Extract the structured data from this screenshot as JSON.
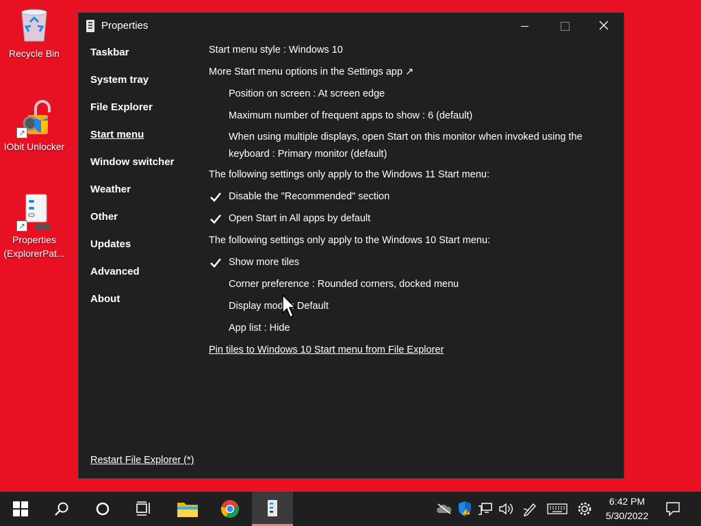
{
  "desktop": {
    "icons": [
      {
        "label": "Recycle Bin"
      },
      {
        "label": "IObit Unlocker"
      },
      {
        "label": "Properties (ExplorerPat..."
      }
    ]
  },
  "window": {
    "title": "Properties",
    "nav": [
      "Taskbar",
      "System tray",
      "File Explorer",
      "Start menu",
      "Window switcher",
      "Weather",
      "Other",
      "Updates",
      "Advanced",
      "About"
    ],
    "active_nav": "Start menu",
    "settings": {
      "start_style": "Start menu style : Windows 10",
      "more_options": "More Start menu options in the Settings app ↗",
      "position": "Position on screen : At screen edge",
      "max_frequent": "Maximum number of frequent apps to show : 6 (default)",
      "multi_display": "When using multiple displays, open Start on this monitor when invoked using the keyboard : Primary monitor (default)",
      "win11_header": "The following settings only apply to the Windows 11 Start menu:",
      "disable_recommended": "Disable the \"Recommended\" section",
      "open_all_apps": "Open Start in All apps by default",
      "win10_header": "The following settings only apply to the Windows 10 Start menu:",
      "show_more_tiles": "Show more tiles",
      "corner_pref": "Corner preference : Rounded corners, docked menu",
      "display_mode": "Display mode : Default",
      "app_list": "App list : Hide",
      "pin_tiles": "Pin tiles to Windows 10 Start menu from File Explorer"
    },
    "checked": {
      "disable_recommended": true,
      "open_all_apps": true,
      "show_more_tiles": true
    },
    "restart": "Restart File Explorer (*)"
  },
  "taskbar": {
    "time": "6:42 PM",
    "date": "5/30/2022"
  },
  "colors": {
    "desktop": "#e81123",
    "window_bg": "#202020",
    "taskbar_bg": "#1f1f1f"
  }
}
